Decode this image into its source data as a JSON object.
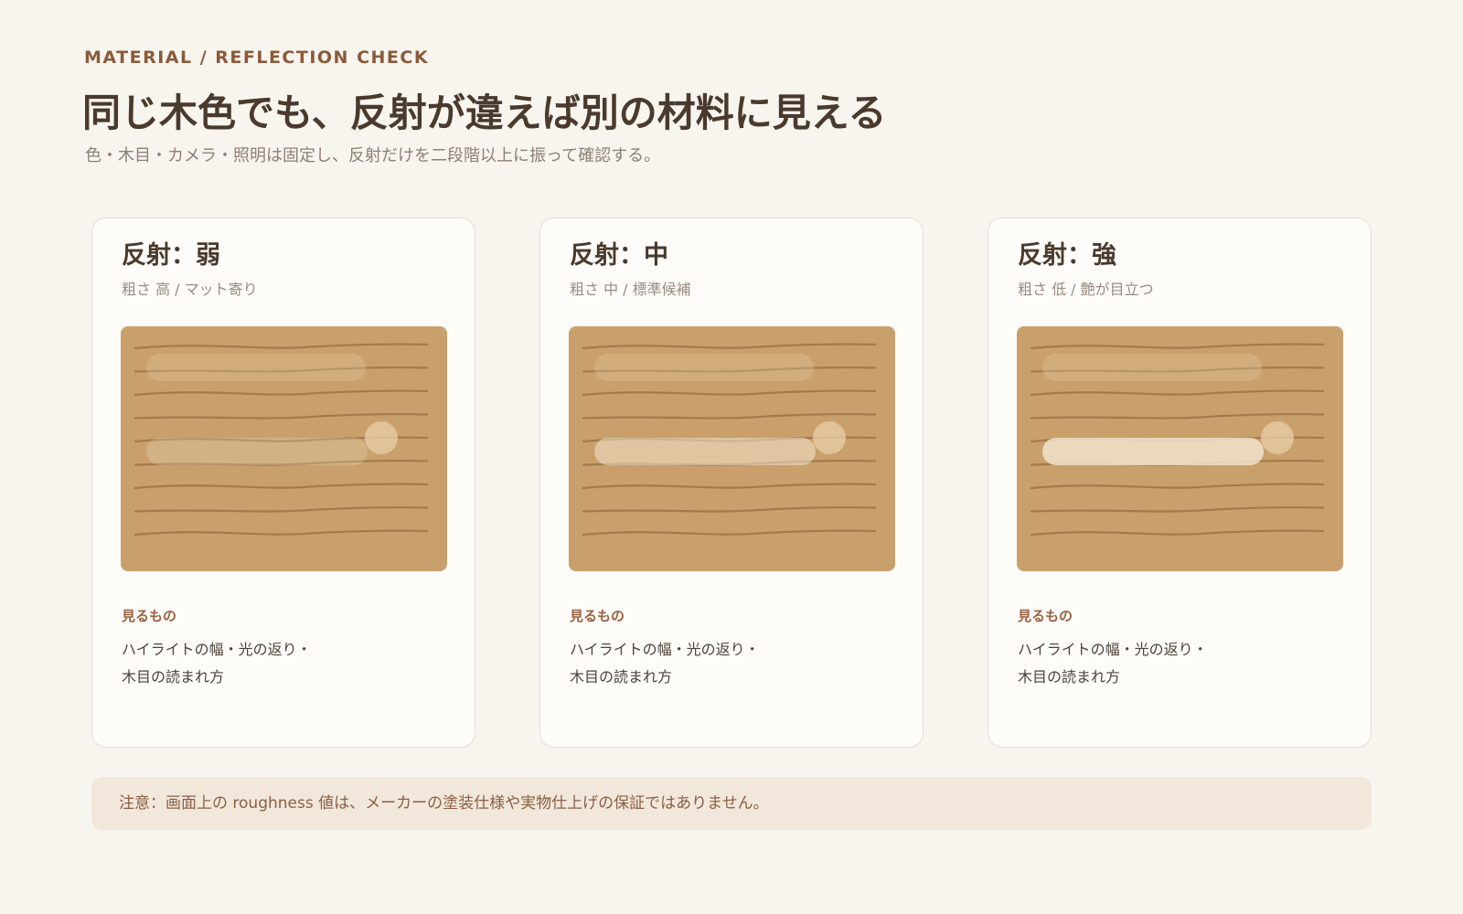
{
  "header": {
    "eyebrow": "MATERIAL / REFLECTION CHECK",
    "title": "同じ木色でも、反射が違えば別の材料に見える",
    "subtitle": "色・木目・カメラ・照明は固定し、反射だけを二段階以上に振って確認する。"
  },
  "colors": {
    "background": "#f8f5ef",
    "wood": "#c9a06b",
    "grain": "#9a7448",
    "accent": "#8a5a3a",
    "note_background": "#f1e7da"
  },
  "cards": [
    {
      "title": "反射：弱",
      "subtitle": "粗さ 高 / マット寄り",
      "look_label": "見るもの",
      "look_line1": "ハイライトの幅・光の返り・",
      "look_line2": "木目の読まれ方",
      "highlight_strength": 0.25
    },
    {
      "title": "反射：中",
      "subtitle": "粗さ 中 / 標準候補",
      "look_label": "見るもの",
      "look_line1": "ハイライトの幅・光の返り・",
      "look_line2": "木目の読まれ方",
      "highlight_strength": 0.55
    },
    {
      "title": "反射：強",
      "subtitle": "粗さ 低 / 艶が目立つ",
      "look_label": "見るもの",
      "look_line1": "ハイライトの幅・光の返り・",
      "look_line2": "木目の読まれ方",
      "highlight_strength": 0.85
    }
  ],
  "note": {
    "text": "注意：画面上の roughness 値は、メーカーの塗装仕様や実物仕上げの保証ではありません。"
  }
}
